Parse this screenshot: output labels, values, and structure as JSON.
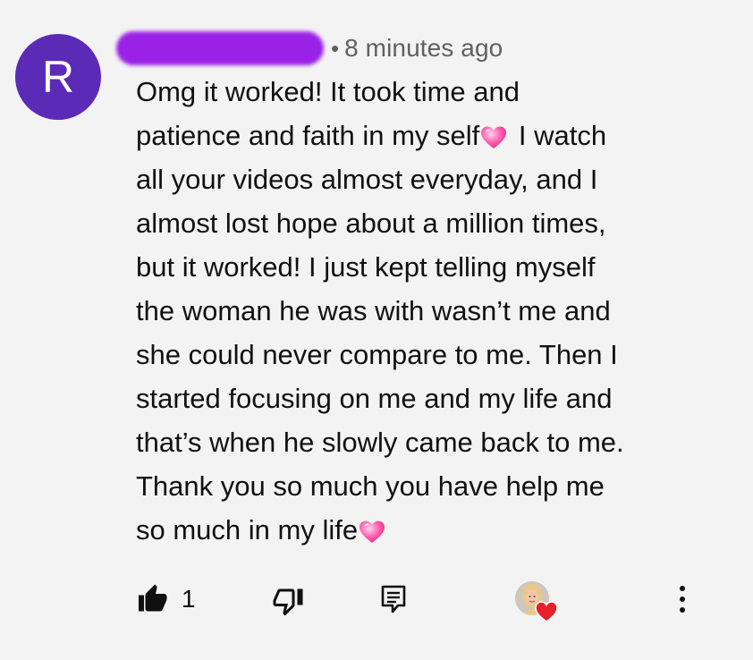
{
  "comment": {
    "avatar_letter": "R",
    "timestamp": "8 minutes ago",
    "separator": "•",
    "lines": [
      "Omg it worked! It took time and",
      "patience and faith in my self",
      " I watch",
      "all your videos almost everyday, and I",
      "almost lost hope about a million times,",
      "but it worked! I just kept telling myself",
      "the woman he was with wasn’t me and",
      "she could never compare to me. Then I",
      "started focusing on me and my life and",
      "that’s when he slowly came back to me.",
      "Thank you so much you have help me",
      "so much in my life"
    ]
  },
  "actions": {
    "like_count": "1"
  },
  "colors": {
    "avatar_bg": "#5b2bb8",
    "name_redaction": "#9a22e6",
    "heart_red": "#e8202a",
    "emoji_pink": "#ff4fa3"
  },
  "icons": {
    "like": "thumb-up-icon",
    "dislike": "thumb-down-icon",
    "reply": "comment-icon",
    "creator_heart": "creator-heart-icon",
    "more": "more-vert-icon",
    "emoji": "sparkling-heart-emoji"
  }
}
